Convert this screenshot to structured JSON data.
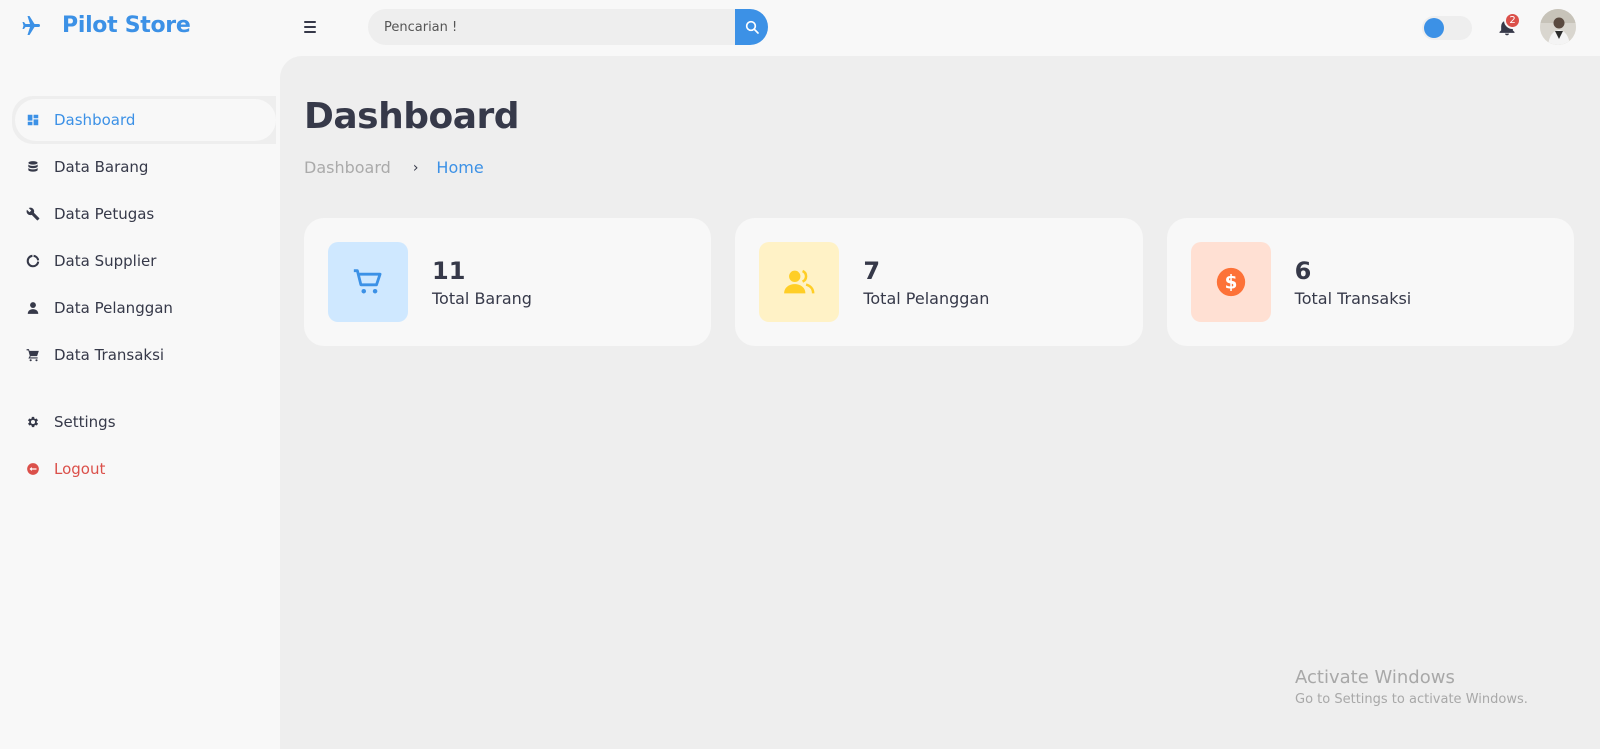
{
  "app": {
    "brand_name": "Pilot Store",
    "brand_icon": "plane-icon",
    "accent_color": "#3c91e6"
  },
  "header": {
    "menu_icon": "hamburger-icon",
    "search_placeholder": "Pencarian !",
    "search_icon": "search-icon",
    "theme_toggle": "theme-switch",
    "notification_icon": "bell-icon",
    "notification_count": "2",
    "avatar": "user-avatar"
  },
  "sidebar": {
    "items": [
      {
        "label": "Dashboard",
        "icon": "dashboard-grid-icon",
        "active": true
      },
      {
        "label": "Data Barang",
        "icon": "database-icon"
      },
      {
        "label": "Data Petugas",
        "icon": "wrench-icon"
      },
      {
        "label": "Data Supplier",
        "icon": "donut-chart-icon"
      },
      {
        "label": "Data Pelanggan",
        "icon": "user-icon"
      },
      {
        "label": "Data Transaksi",
        "icon": "cart-icon"
      }
    ],
    "settings_label": "Settings",
    "logout_label": "Logout"
  },
  "main": {
    "title": "Dashboard",
    "breadcrumb": [
      "Dashboard",
      "Home"
    ],
    "cards": [
      {
        "value": "11",
        "label": "Total Barang",
        "icon": "cart-icon",
        "bg": "#cfe8ff",
        "color": "#3c91e6"
      },
      {
        "value": "7",
        "label": "Total Pelanggan",
        "icon": "group-icon",
        "bg": "#fff2c6",
        "color": "#ffce26"
      },
      {
        "value": "6",
        "label": "Total Transaksi",
        "icon": "dollar-icon",
        "bg": "#ffe0d3",
        "color": "#fd7238"
      }
    ]
  },
  "watermark": {
    "title": "Activate Windows",
    "subtitle": "Go to Settings to activate Windows."
  }
}
